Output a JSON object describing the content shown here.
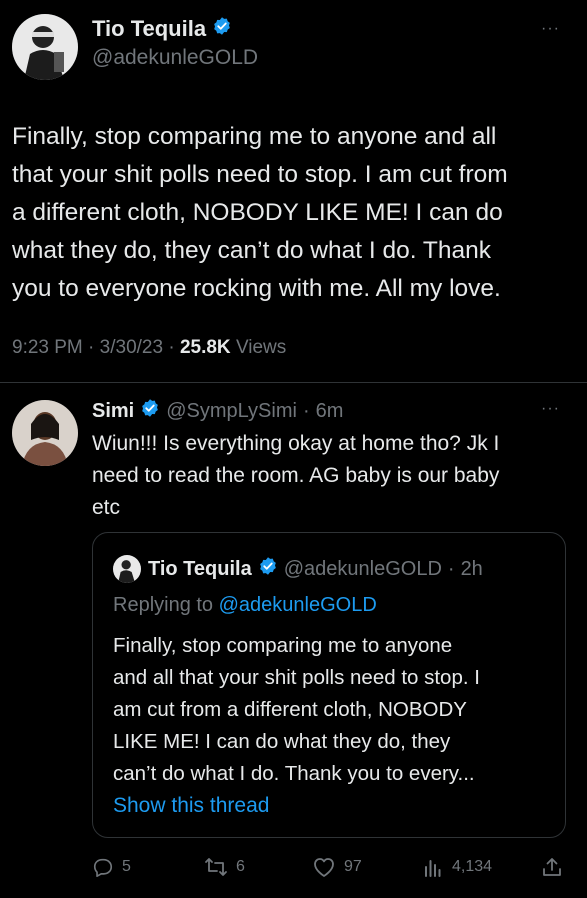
{
  "main_tweet": {
    "author_name": "Tio Tequila",
    "handle": "@adekunleGOLD",
    "more": "···",
    "text": "Finally, stop comparing me to anyone and all that your shit polls need to stop. I am cut from a different cloth, NOBODY LIKE ME! I can do what they do, they can’t do what I do. Thank you to everyone rocking with me. All my love.",
    "text_lines": [
      "Finally, stop comparing me to anyone and all",
      "that your shit polls need to stop. I am cut from",
      "a different cloth, NOBODY LIKE ME! I can do",
      "what they do, they can’t do what I do. Thank",
      "you to everyone rocking with me. All my love."
    ],
    "time": "9:23 PM",
    "date": "3/30/23",
    "views_count": "25.8K",
    "views_label": "Views",
    "sep": "·"
  },
  "reply_tweet": {
    "author_name": "Simi",
    "handle": "@SympLySimi",
    "time_ago": "6m",
    "more": "···",
    "text_lines": [
      "Wiun!!! Is everything okay at home tho? Jk I",
      "need to read the room. AG baby is our baby",
      "etc"
    ],
    "quoted": {
      "author_name": "Tio Tequila",
      "handle": "@adekunleGOLD",
      "time_ago": "2h",
      "replying_to_label": "Replying to",
      "replying_to_handle": "@adekunleGOLD",
      "text_lines": [
        "Finally, stop comparing me to anyone",
        "and all that your shit polls need to stop. I",
        "am cut from a different cloth, NOBODY",
        "LIKE ME! I can do what they do, they",
        "can’t do what I do. Thank you to every..."
      ],
      "show_thread": "Show this thread"
    },
    "actions": {
      "replies": "5",
      "retweets": "6",
      "likes": "97",
      "views": "4,134"
    }
  },
  "icons": {
    "verified": "verified-badge-icon",
    "reply": "reply-icon",
    "retweet": "retweet-icon",
    "like": "heart-icon",
    "views": "analytics-icon",
    "share": "share-icon"
  },
  "colors": {
    "background": "#000000",
    "text": "#e7e9ea",
    "muted": "#71767b",
    "accent": "#1d9bf0",
    "border": "#2f3336"
  }
}
